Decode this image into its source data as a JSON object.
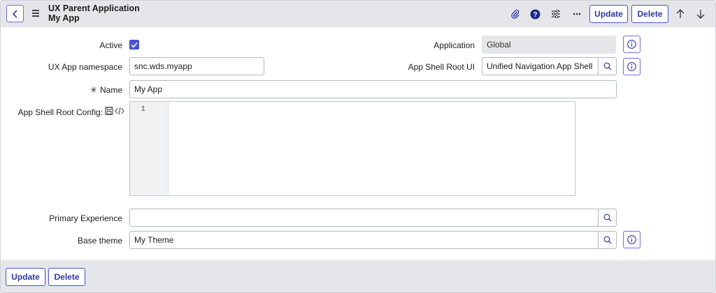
{
  "header": {
    "title_line1": "UX Parent Application",
    "title_line2": "My App",
    "update_label": "Update",
    "delete_label": "Delete"
  },
  "form": {
    "active": {
      "label": "Active",
      "checked": true
    },
    "application": {
      "label": "Application",
      "value": "Global"
    },
    "namespace": {
      "label": "UX App namespace",
      "value": "snc.wds.myapp"
    },
    "shell_root_ui": {
      "label": "App Shell Root UI",
      "value": "Unified Navigation App Shell"
    },
    "name": {
      "required_mark": "✳",
      "label": "Name",
      "value": "My App"
    },
    "shell_root_config": {
      "label": "App Shell Root Config:",
      "line_number": "1"
    },
    "primary_experience": {
      "label": "Primary Experience",
      "value": ""
    },
    "base_theme": {
      "label": "Base theme",
      "value": "My Theme"
    }
  },
  "footer": {
    "update_label": "Update",
    "delete_label": "Delete"
  },
  "colors": {
    "accent": "#4b55c8",
    "header_bg": "#e4e6e9"
  },
  "icons": [
    "chevron-left-icon",
    "hamburger-menu-icon",
    "paperclip-icon",
    "help-icon",
    "settings-sliders-icon",
    "more-icon",
    "arrow-up-icon",
    "arrow-down-icon",
    "info-icon",
    "search-icon",
    "save-icon",
    "code-icon",
    "checkmark-icon"
  ]
}
